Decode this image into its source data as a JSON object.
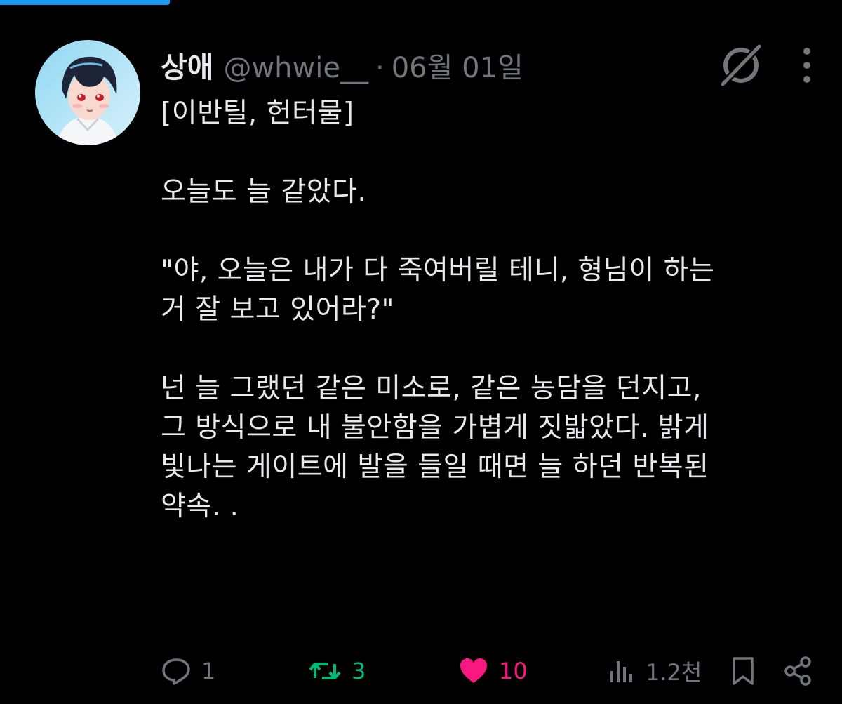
{
  "colors": {
    "background": "#000000",
    "text_primary": "#e7e9ea",
    "text_secondary": "#71767b",
    "retweet_active": "#00ba7c",
    "like_active": "#f91880",
    "accent_tab": "#1d9bf0"
  },
  "tweet": {
    "display_name": "상애",
    "handle": "@whwie__",
    "separator": "·",
    "date": "06월 01일",
    "icons": {
      "grok": "grok-icon",
      "more": "more-dots-icon"
    },
    "body": [
      "[이반틸, 헌터물]",
      "",
      "오늘도 늘 같았다.",
      "",
      "\"야, 오늘은 내가 다 죽여버릴 테니, 형님이 하는\n거 잘 보고 있어라?\"",
      "",
      "넌 늘 그랬던 같은 미소로, 같은 농담을 던지고,\n그 방식으로 내 불안함을 가볍게 짓밟았다. 밝게\n빛나는 게이트에 발을 들일 때면 늘 하던 반복된\n약속. ."
    ],
    "actions": {
      "reply_count": "1",
      "retweet_count": "3",
      "like_count": "10",
      "view_count": "1.2천"
    }
  }
}
